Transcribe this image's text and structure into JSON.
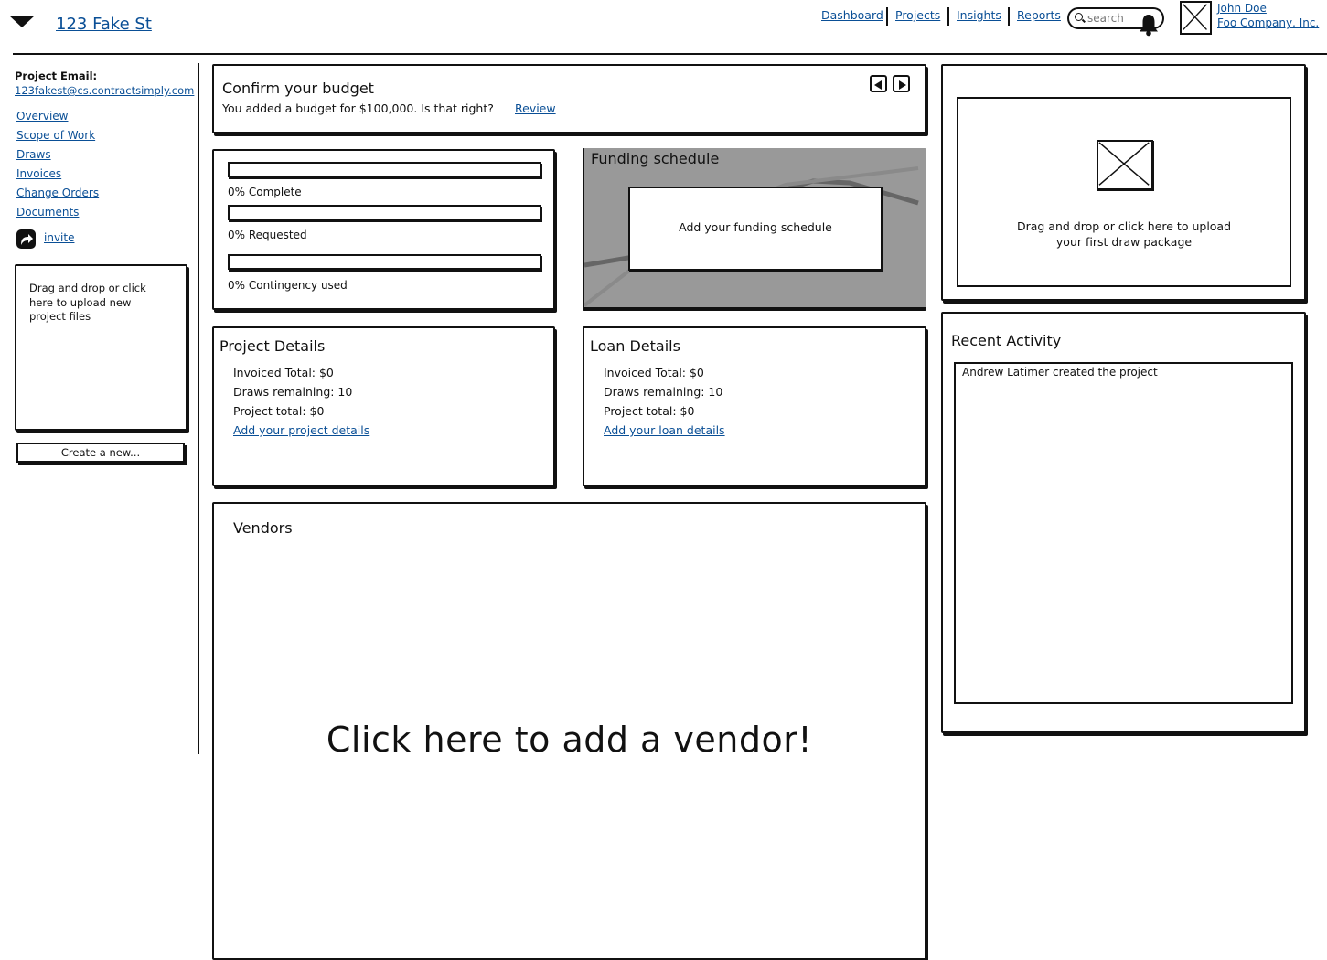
{
  "header": {
    "project_title": "123 Fake St",
    "nav": [
      "Dashboard",
      "Projects",
      "Insights",
      "Reports"
    ],
    "search_placeholder": "search",
    "user": {
      "name": "John Doe",
      "company": "Foo Company, Inc."
    }
  },
  "sidebar": {
    "email_label": "Project Email:",
    "email": "123fakest@cs.contractsimply.com",
    "links": [
      "Overview",
      "Scope of Work",
      "Draws",
      "Invoices",
      "Change Orders",
      "Documents"
    ],
    "invite_label": "invite",
    "upload_text": "Drag and drop or click here to upload new project files",
    "create_button": "Create a new..."
  },
  "budget": {
    "title": "Confirm your budget",
    "message": "You added a budget for $100,000. Is that right?",
    "review_link": "Review"
  },
  "progress": [
    {
      "label": "0% Complete",
      "value": 0
    },
    {
      "label": "0% Requested",
      "value": 0
    },
    {
      "label": "0% Contingency used",
      "value": 0
    }
  ],
  "funding": {
    "title": "Funding schedule",
    "cta": "Add your funding schedule"
  },
  "project_details": {
    "title": "Project Details",
    "lines": [
      "Invoiced Total: $0",
      "Draws remaining: 10",
      "Project total: $0"
    ],
    "link": "Add your project details"
  },
  "loan_details": {
    "title": "Loan Details",
    "lines": [
      "Invoiced Total: $0",
      "Draws remaining: 10",
      "Project total: $0"
    ],
    "link": "Add your loan details"
  },
  "vendors": {
    "title": "Vendors",
    "cta": "Click here to add a vendor!"
  },
  "draw_upload": {
    "text_line1": "Drag and drop or click here to upload",
    "text_line2": "your first draw package"
  },
  "activity": {
    "title": "Recent Activity",
    "items": [
      "Andrew Latimer created the project"
    ]
  },
  "icons": {
    "menu": "triangle-down-icon",
    "search": "search-icon",
    "notifications": "bell-icon",
    "avatar": "image-placeholder-icon",
    "invite": "share-arrow-icon",
    "prev": "previous-icon",
    "next": "next-icon"
  }
}
